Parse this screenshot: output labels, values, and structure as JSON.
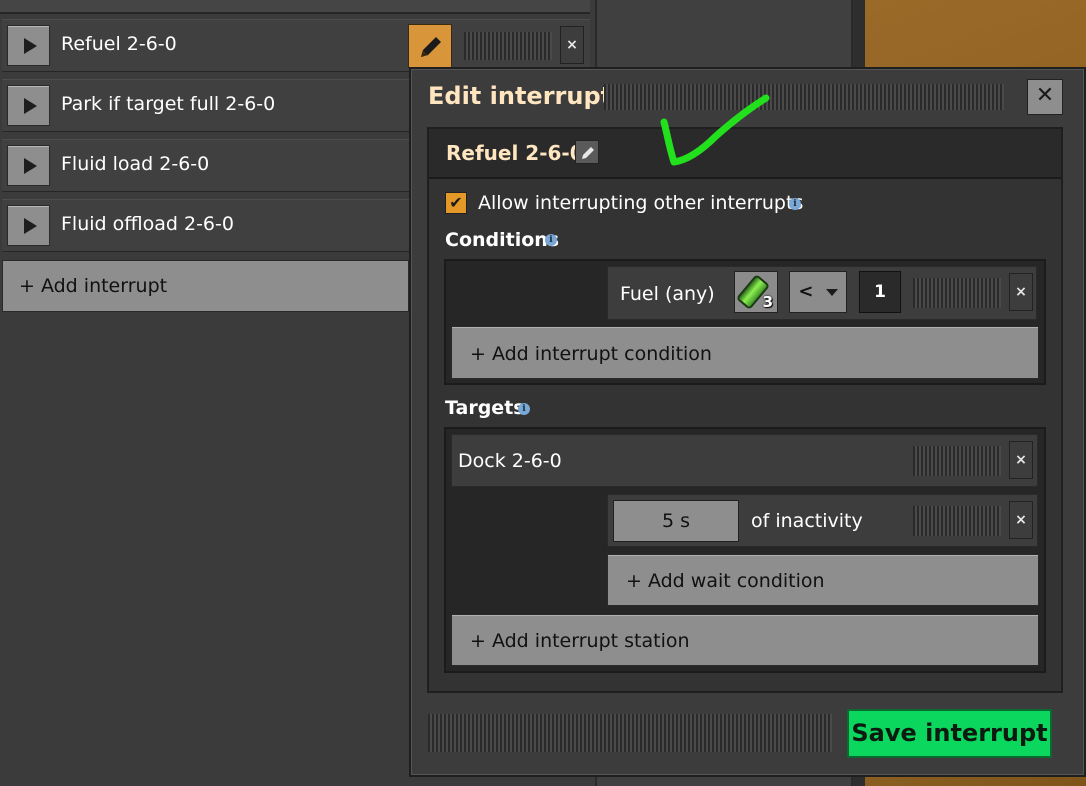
{
  "interrupt_list": {
    "items": [
      {
        "label": "Refuel 2-6-0"
      },
      {
        "label": "Park if target full 2-6-0"
      },
      {
        "label": "Fluid load 2-6-0"
      },
      {
        "label": "Fluid offload 2-6-0"
      }
    ],
    "add_label": "+ Add interrupt",
    "remove_glyph": "×"
  },
  "dialog": {
    "title": "Edit interrupt",
    "close_glyph": "✕",
    "interrupt_name": "Refuel 2-6-0",
    "allow_interrupting": {
      "checked": true,
      "checkmark": "✔",
      "label": "Allow interrupting other interrupts"
    },
    "info_glyph": "i",
    "conditions": {
      "heading": "Conditions",
      "rows": [
        {
          "label": "Fuel (any)",
          "item_icon": "battery-icon",
          "item_count": "3",
          "comparator": "<",
          "value": "1"
        }
      ],
      "add_label": "+ Add interrupt condition"
    },
    "targets": {
      "heading": "Targets",
      "stations": [
        {
          "name": "Dock 2-6-0",
          "wait_conditions": [
            {
              "time": "5 s",
              "label": "of inactivity"
            }
          ],
          "add_wait_label": "+ Add wait condition"
        }
      ],
      "add_station_label": "+ Add interrupt station"
    },
    "save_label": "Save interrupt"
  },
  "colors": {
    "accent_orange": "#e39827",
    "save_green": "#0bd65e",
    "annotation_green": "#22e01c",
    "title_text": "#ffe6c0"
  }
}
